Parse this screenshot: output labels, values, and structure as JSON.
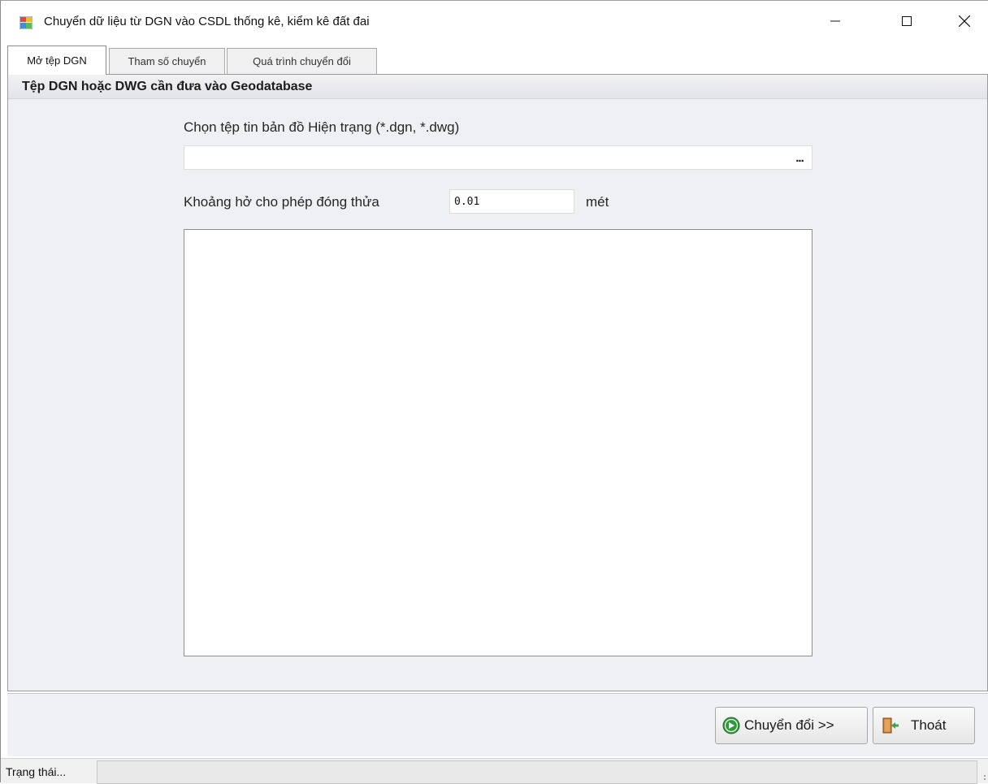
{
  "window": {
    "title": "Chuyển dữ liệu từ DGN vào CSDL thống kê, kiểm kê đất đai",
    "icons": {
      "app": "app-window-icon",
      "minimize": "minimize-icon",
      "maximize": "maximize-icon",
      "close": "close-icon"
    }
  },
  "tabs": [
    {
      "label": "Mở tệp DGN",
      "active": true
    },
    {
      "label": "Tham số chuyển",
      "active": false
    },
    {
      "label": "Quá trình chuyển đổi",
      "active": false
    }
  ],
  "panel": {
    "header": "Tệp DGN hoặc DWG cần đưa vào Geodatabase",
    "file_label": "Chọn tệp tin bản đồ Hiện trạng (*.dgn, *.dwg)",
    "file_value": "",
    "browse_label": "...",
    "tolerance_label": "Khoảng hở cho phép đóng thửa",
    "tolerance_value": "0.01",
    "tolerance_unit": "mét",
    "log_text": ""
  },
  "buttons": {
    "convert_label": "Chuyển đổi >>",
    "exit_label": "Thoát",
    "convert_icon": "arrow-right-circle-icon",
    "exit_icon": "exit-door-icon"
  },
  "status": {
    "label": "Trạng thái...",
    "value": ""
  },
  "colors": {
    "panel_bg": "#eff0f3",
    "convert_icon_green": "#2e9b3a"
  }
}
